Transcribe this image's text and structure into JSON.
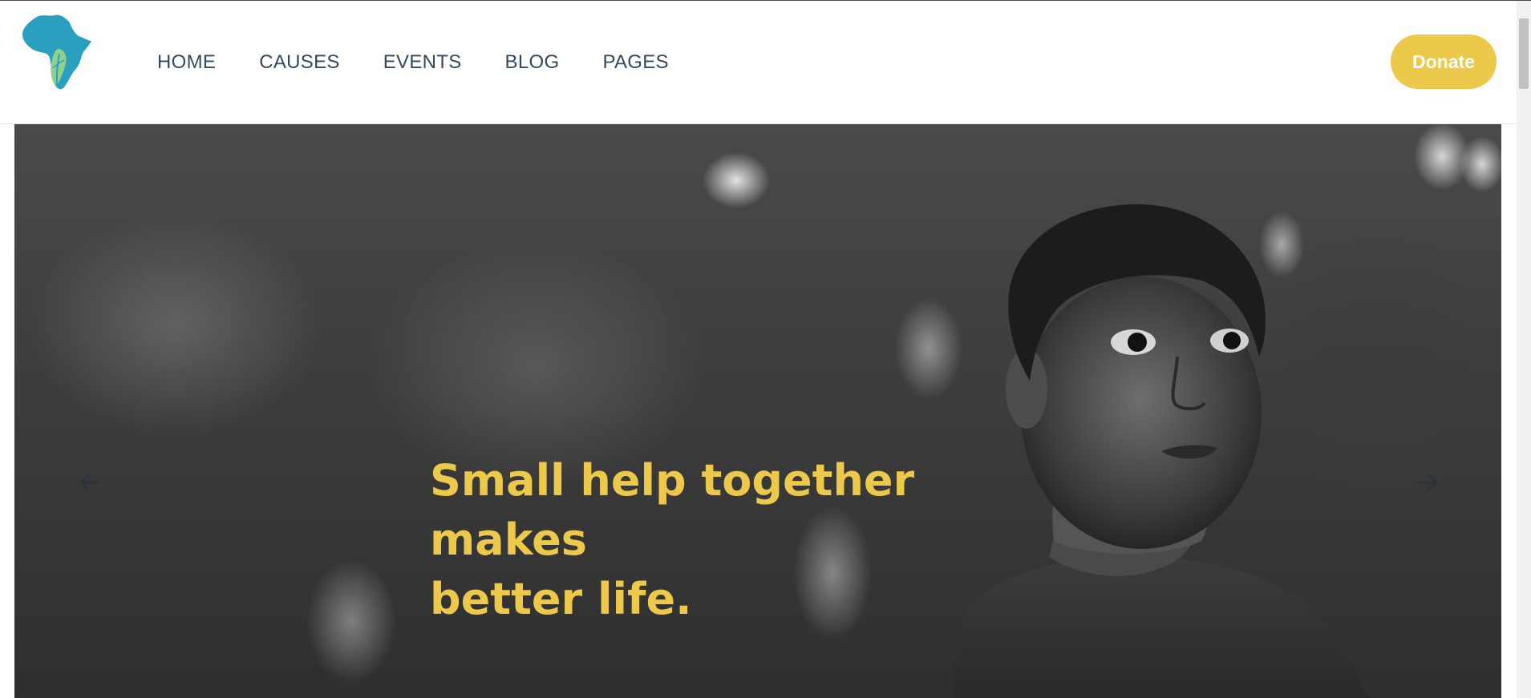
{
  "nav": {
    "items": [
      {
        "label": "HOME"
      },
      {
        "label": "CAUSES"
      },
      {
        "label": "EVENTS"
      },
      {
        "label": "BLOG"
      },
      {
        "label": "PAGES"
      }
    ]
  },
  "header": {
    "donate_label": "Donate"
  },
  "hero": {
    "title_line1": "Small help together makes",
    "title_line2": "better life.",
    "prev_icon": "arrow-left-icon",
    "next_icon": "arrow-right-icon"
  },
  "colors": {
    "accent": "#ecc94b",
    "nav_text": "#34495e",
    "logo_blue": "#2a9fbf",
    "logo_green": "#8fd18b"
  }
}
